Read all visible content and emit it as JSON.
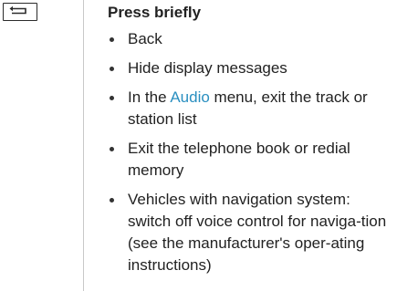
{
  "key": {
    "icon": "back-arrow-icon"
  },
  "section": {
    "heading": "Press briefly",
    "items": [
      {
        "text": "Back"
      },
      {
        "text": "Hide display messages"
      },
      {
        "pre": "In the ",
        "link": "Audio",
        "post": " menu, exit the track or station list"
      },
      {
        "text": "Exit the telephone book or redial memory"
      },
      {
        "text": "Vehicles with navigation system: switch off voice control for naviga-tion (see the manufacturer's oper-ating instructions)"
      }
    ]
  },
  "colors": {
    "link": "#2a8fc0",
    "text": "#222222",
    "divider": "#c8c8c8"
  }
}
